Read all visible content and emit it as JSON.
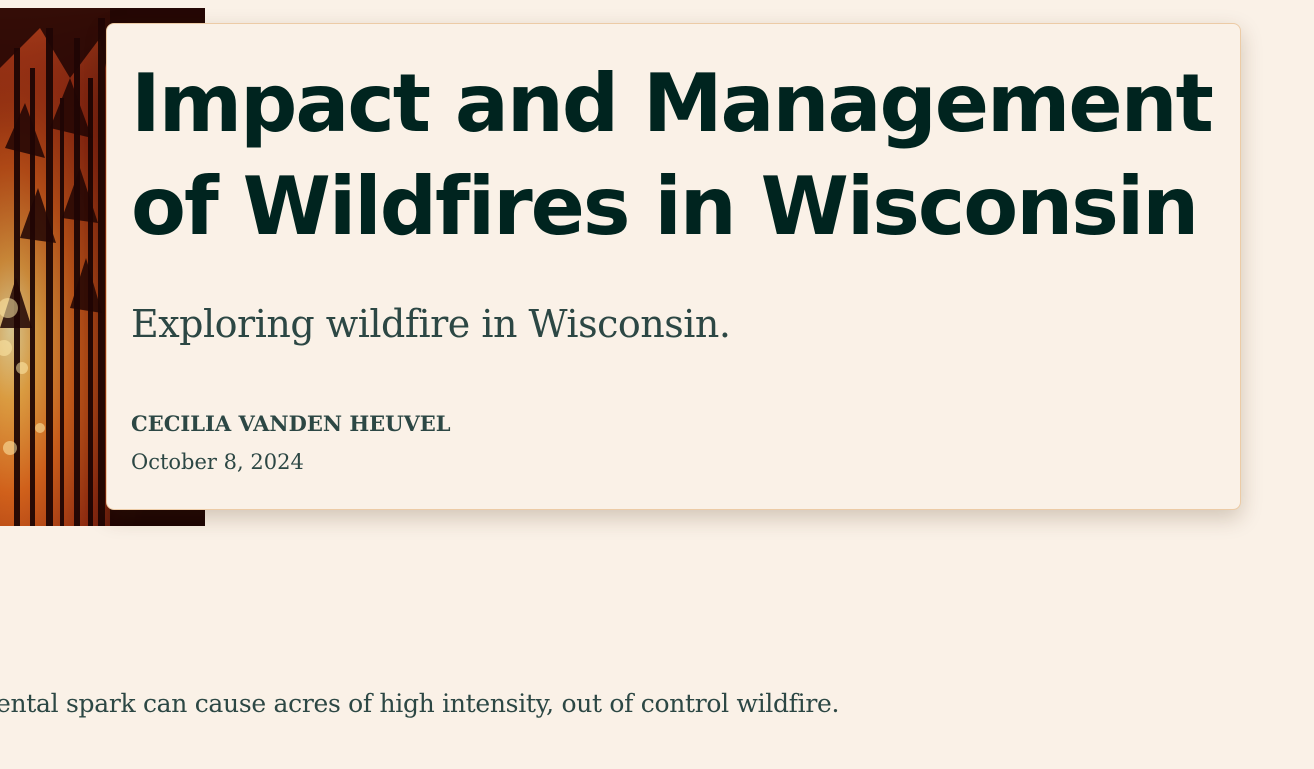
{
  "hero": {
    "image_icon": "forest-fire-photo"
  },
  "article": {
    "title_line1": "Impact and Management",
    "title_line2": "of Wildfires in Wisconsin",
    "subtitle": "Exploring wildfire in Wisconsin.",
    "author": "CECILIA VANDEN HEUVEL",
    "date": "October 8, 2024",
    "body_fragment": "ental spark can cause acres of high intensity, out of control wildfire."
  },
  "colors": {
    "background": "#faf1e7",
    "title": "#00241f",
    "text": "#2c4744",
    "card_border": "#eccba6",
    "fire_orange": "#e07a1c"
  }
}
